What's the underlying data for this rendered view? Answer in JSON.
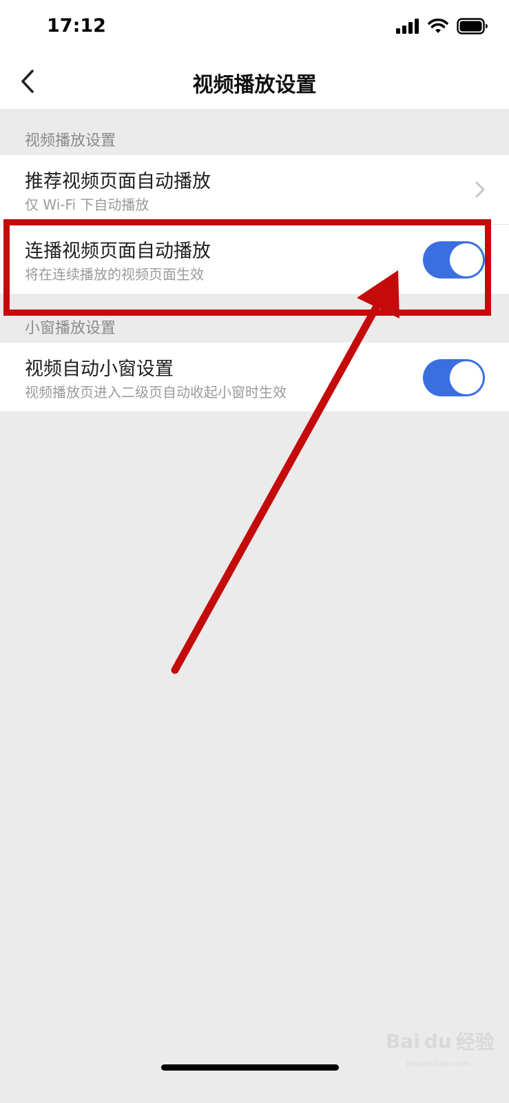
{
  "status_bar": {
    "time": "17:12",
    "icons": [
      "signal-icon",
      "wifi-icon",
      "battery-icon"
    ]
  },
  "nav": {
    "back_icon": "chevron-left-icon",
    "title": "视频播放设置"
  },
  "sections": [
    {
      "header": "视频播放设置",
      "rows": [
        {
          "title": "推荐视频页面自动播放",
          "subtitle": "仅 Wi-Fi 下自动播放",
          "control": "chevron-right-icon"
        },
        {
          "title": "连播视频页面自动播放",
          "subtitle": "将在连续播放的视频页面生效",
          "control": "toggle",
          "on": true
        }
      ]
    },
    {
      "header": "小窗播放设置",
      "rows": [
        {
          "title": "视频自动小窗设置",
          "subtitle": "视频播放页进入二级页自动收起小窗时生效",
          "control": "toggle",
          "on": true
        }
      ]
    }
  ],
  "annotation": {
    "color": "#c40a0a"
  },
  "watermark": {
    "text": "Bai",
    "paw": "du",
    "cn": "经验",
    "url": "jingyan.baidu.com"
  },
  "colors": {
    "toggle_on": "#3b6fe0",
    "background": "#ebebeb"
  }
}
